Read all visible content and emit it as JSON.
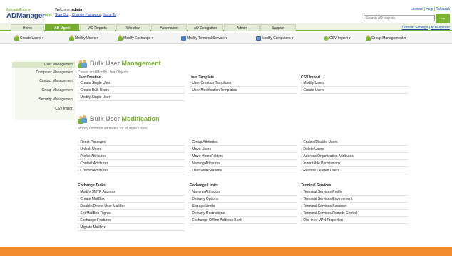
{
  "header": {
    "logo_small": "ManageEngine",
    "logo_big": "ADManager",
    "logo_plus": "Plus",
    "welcome_prefix": "Welcome,",
    "username": "admin",
    "sign_out": "Sign Out",
    "change_password": "Change Password",
    "jump_to": "Jump To",
    "links": [
      "License",
      "Help",
      "Talkback"
    ],
    "search_placeholder": "Search AD objects"
  },
  "tabs": [
    "Home",
    "AD Mgmt",
    "AD Reports",
    "Workflow",
    "Automation",
    "AD Delegation",
    "Admin",
    "Support"
  ],
  "active_tab": "AD Mgmt",
  "tab_links": [
    "Domain Settings",
    "AD Explorer"
  ],
  "subtoolbar": [
    "Create Users",
    "Modify Users",
    "Modify Exchange",
    "Modify Terminal Service",
    "Modify Computers",
    "CSV Import",
    "Group Management"
  ],
  "leftnav": [
    "User Management",
    "Computer Management",
    "Contact Management",
    "Group Management",
    "Security Management",
    "CSV Import"
  ],
  "bulk_user_management": {
    "title_a": "Bulk User",
    "title_b": "Management",
    "subtitle": "Create and Modify User Objects",
    "columns": [
      {
        "header": "User Creation",
        "items": [
          "Create Single User",
          "Create Bulk Users",
          "Modify Single User"
        ]
      },
      {
        "header": "User Template",
        "items": [
          "User Creation Templates",
          "User Modification Templates"
        ]
      },
      {
        "header": "CSV Import",
        "items": [
          "Modify Users",
          "Create Users"
        ]
      }
    ]
  },
  "bulk_user_modification": {
    "title_a": "Bulk User",
    "title_b": "Modification",
    "subtitle": "Modify common attributes for Multiple Users.",
    "columns": [
      {
        "items": [
          "Reset Password",
          "Unlock Users",
          "Profile Attributes",
          "Contact Attributes",
          "Custom Attributes"
        ]
      },
      {
        "items": [
          "Group Attributes",
          "Move Users",
          "Move HomeFolders",
          "Naming Attributes",
          "User WorkStations"
        ]
      },
      {
        "items": [
          "Enable/Disable Users",
          "Delete Users",
          "Address/Organization Attributes",
          "Inheritable Permissions",
          "Restore Deleted Users"
        ]
      }
    ]
  },
  "lower_sections": [
    {
      "header": "Exchange Tasks",
      "items": [
        "Modify SMTP Address",
        "Create MailBox",
        "Disable/Delete User MailBox",
        "Set MailBox Rights",
        "Exchange Features",
        "Migrate Mailbox"
      ]
    },
    {
      "header": "Exchange Limits",
      "items": [
        "Naming Attributes",
        "Delivery Options",
        "Storage Limits",
        "Delivery Restrictions",
        "Exchange Offline Address Book"
      ]
    },
    {
      "header": "Terminal Services",
      "items": [
        "Terminal Services Profile",
        "Terminal Services Environment",
        "Terminal Services Sessions",
        "Terminal Services Remote Control",
        "Dial-in or VPN Properties"
      ]
    }
  ],
  "colors": {
    "accent": "#76ad2e",
    "link": "#1a50a8",
    "footer": "#f08b2e"
  }
}
